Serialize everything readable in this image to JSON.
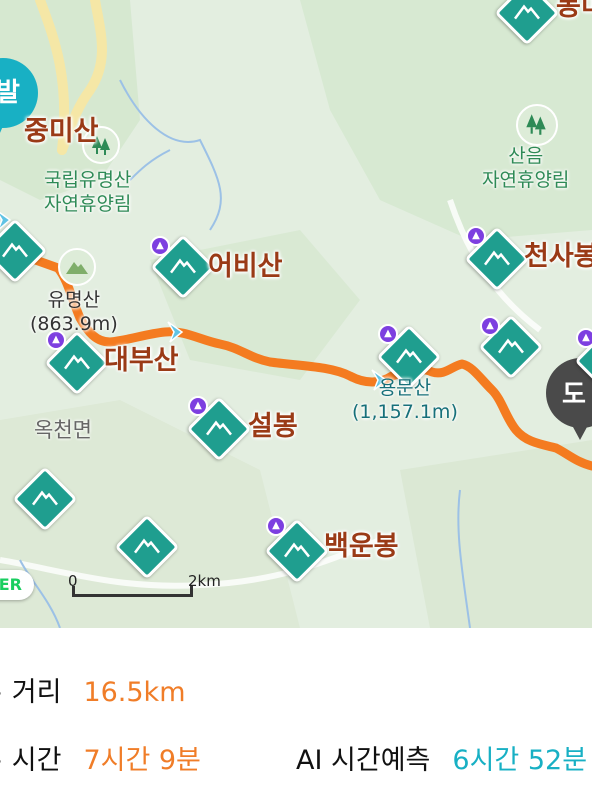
{
  "colors": {
    "route": "#f47b20",
    "accent_orange": "#f07d28",
    "accent_teal": "#18b0c4",
    "peak_label": "#9a3a16",
    "mountain_marker": "#1f9e8f"
  },
  "map": {
    "start_marker": "발",
    "end_marker": "도",
    "naver_badge": "ER",
    "peaks": [
      {
        "name": "중미산"
      },
      {
        "name": "어비산"
      },
      {
        "name": "대부산"
      },
      {
        "name": "설봉"
      },
      {
        "name": "백운봉"
      },
      {
        "name": "천사봉"
      },
      {
        "name": "봉미"
      }
    ],
    "forests": [
      {
        "line1": "국립유명산",
        "line2": "자연휴양림"
      },
      {
        "line1": "산음",
        "line2": "자연휴양림"
      }
    ],
    "yumyeongsan": {
      "name": "유명산",
      "elevation": "(863.9m)"
    },
    "yongmunsan": {
      "name": "용문산",
      "elevation": "(1,157.1m)"
    },
    "area_label": "옥천면",
    "scale_bar": {
      "start": "0",
      "end": "2km"
    },
    "icons": [
      "mountain-icon",
      "tree-icon",
      "route-arrow-icon"
    ]
  },
  "info": {
    "distance_label": "거리",
    "distance_value": "16.5km",
    "time_label": "시간",
    "time_value": "7시간 9분",
    "ai_label": "AI 시간예측",
    "ai_value": "6시간 52분"
  }
}
